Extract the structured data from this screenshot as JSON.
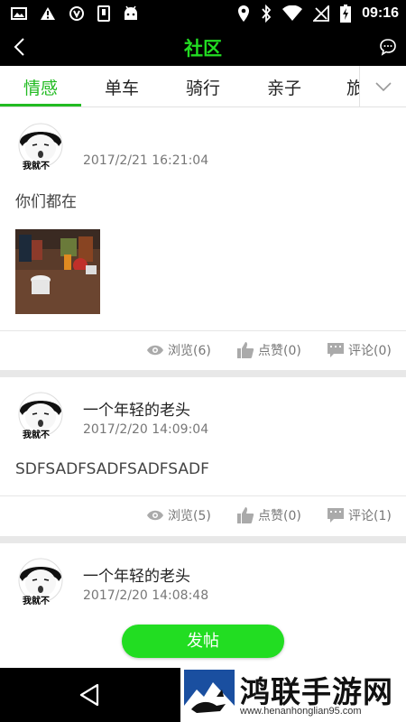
{
  "status_bar": {
    "time": "09:16",
    "left_icons": [
      "image-icon",
      "warning-icon",
      "shield-icon",
      "phone-icon",
      "android-icon"
    ],
    "right_icons": [
      "location-icon",
      "bluetooth-icon",
      "wifi-icon",
      "no-signal-icon",
      "battery-charging-icon"
    ]
  },
  "header": {
    "title": "社区",
    "back_icon": "chevron-left-icon",
    "message_icon": "chat-bubble-icon"
  },
  "tabs": {
    "items": [
      "情感",
      "单车",
      "骑行",
      "亲子",
      "旅"
    ],
    "active_index": 0,
    "more_icon": "chevron-down-icon"
  },
  "posts": [
    {
      "author": "",
      "avatar_caption": "我就不",
      "time": "2017/2/21 16:21:04",
      "content": "你们都在",
      "has_photo": true,
      "views_label": "浏览(6)",
      "likes_label": "点赞(0)",
      "comments_label": "评论(0)"
    },
    {
      "author": "一个年轻的老头",
      "avatar_caption": "我就不",
      "time": "2017/2/20 14:09:04",
      "content": "SDFSADFSADFSADFSADF",
      "has_photo": false,
      "views_label": "浏览(5)",
      "likes_label": "点赞(0)",
      "comments_label": "评论(1)"
    },
    {
      "author": "一个年轻的老头",
      "avatar_caption": "我就不",
      "time": "2017/2/20 14:08:48"
    }
  ],
  "post_button": {
    "label": "发帖"
  },
  "watermark": {
    "title": "鸿联手游网",
    "url": "www.henanhonglian95.com"
  },
  "colors": {
    "accent": "#22dd22",
    "tab_active": "#22bb22",
    "bar_bg": "#000000",
    "separator": "#e8e8e8"
  }
}
